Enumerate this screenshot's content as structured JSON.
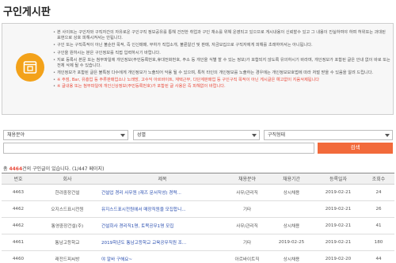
{
  "page": {
    "title": "구인게시판"
  },
  "notice": {
    "icon": "notice-document-icon",
    "lines": [
      "본 사이트는 구인자와 구직자간의 자유로운 구인구직 정보공유를 통해 건전한 취업과 구인 채소를 위해 운영되고 있으므로 게시내용이 신뢰할수 있고 그 내용이 진실하여야 하며 허위또는 과대된 표현으로 상호 피해시켜서는 안됩니다.",
      "구인 또는 구직족적이 아닌 불순한 목적, 즉 인신매매, 부하가 직업소개, 불륜알선 및 판매, 자금모집으로 구직자에게 피해를 초래하여서는 아니됩니다.",
      "구인을 원하시는 분은 구인정보를 직접 입력하시기 바랍니다.",
      "지료 등록시 본문 또는 첨부파일에 개인정보(주민등록번호,휴대전화번호, 주소 등 개인을 식별 할 수 있는 정보)가 포함되지 않도록 유의하시기 바라며, 개인정보가 포함된 글은 안내 없이 바로 또는 전체 삭제 될 수 있습니다.",
      "개인정보가 포함된 글은 불특정 다수에게 개인정보가 노출되어 악용 될 수 있으며, 특히 타인의 개인정보를 노출하는 경우에는 개인정보보호법에 따라 처벌 받을 수 있음을 알려 드립니다.",
      "※ 주점, Bar, 유흥업 등 주류판매업소나 노래방, 고수익 아르바이트, 재택근무, 다단계판매업 등 구인구직 목적이 아닌 게시글은 예고없이 지움삭제됩니다",
      "※ 글내용 또는 첨부파일에 개인신상정보(주민등록번호)가 포함된 글 사용은 즉 피해없이 바랍니다."
    ]
  },
  "filters": {
    "field": "채용분야",
    "gender": "성별",
    "employment_type": "구직형태"
  },
  "search": {
    "placeholder": "",
    "button_label": "검색"
  },
  "summary": {
    "prefix": "총 ",
    "total": "4464",
    "suffix": "건의 구인글이 있습니다. (1/447 페이지)"
  },
  "table": {
    "headers": [
      "번호",
      "회사",
      "제목",
      "채용분야",
      "채용기간",
      "등록일자",
      "조회수"
    ],
    "rows": [
      [
        "4463",
        "한려중장건설",
        "건설업 경리 사무원 (재즈 문서작성) 경력...",
        "사무/관리직",
        "상시채용",
        "2019-02-21",
        "24"
      ],
      [
        "4462",
        "오지스드표시전원",
        "유지스드표시전원에서 매장직원을 모집합니...",
        "기타",
        "",
        "2019-02-21",
        "26"
      ],
      [
        "4462",
        "통영중장건설(주)",
        "건설회사 경리직1명, 토목공무1명 모집",
        "사무/관리직",
        "상시채용",
        "2019-02-21",
        "41"
      ],
      [
        "4461",
        "통남고등학교",
        "2019학년도 통남고등학교 교육공무직원 조...",
        "기타",
        "2019-02-25",
        "2019-02-21",
        "180"
      ],
      [
        "4460",
        "래전드피씨방",
        "야 알바 구해요~",
        "아르바이트직",
        "상시채용",
        "2019-02-20",
        "44"
      ]
    ]
  },
  "colors": {
    "accent": "#f26a3b",
    "notice_icon": "#f3a21a",
    "alert_text": "#e94b3c",
    "link": "#2b4fb0"
  }
}
